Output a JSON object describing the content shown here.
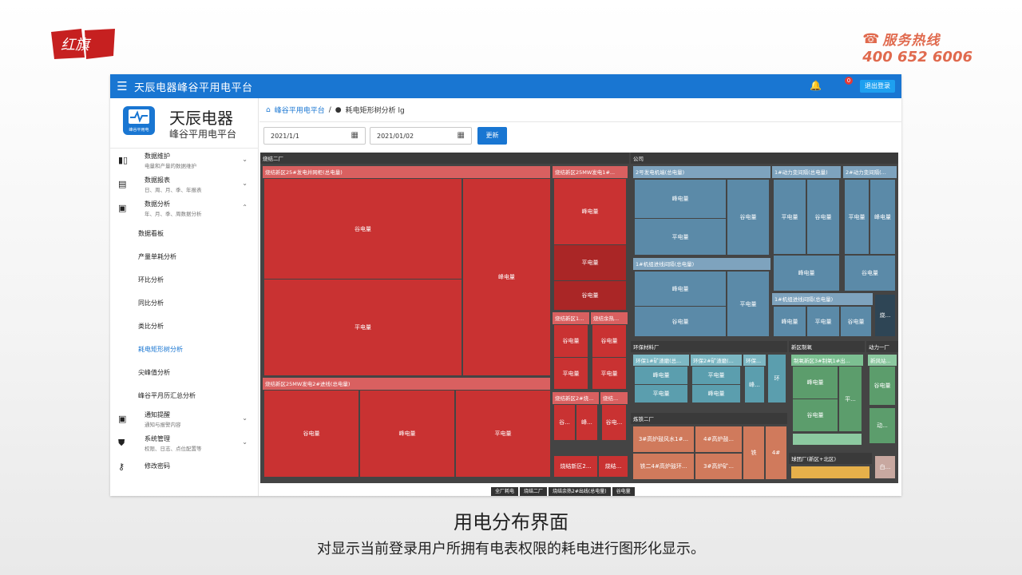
{
  "brand": {
    "logo_text": "红旗",
    "hotline_label": "服务热线",
    "hotline_number": "400 652 6006"
  },
  "app": {
    "title": "天辰电器峰谷平用电平台",
    "notifications": "0",
    "logout_label": "退出登录",
    "sidebar": {
      "name": "天辰电器",
      "subtitle": "峰谷平用电平台",
      "logo_caption": "峰谷平用电",
      "items": [
        {
          "label": "数据维护",
          "desc": "电量和产量的数据维护",
          "icon": "book-icon",
          "chevron": "⌄"
        },
        {
          "label": "数据报表",
          "desc": "日、周、月、季、年报表",
          "icon": "report-icon",
          "chevron": "⌄"
        },
        {
          "label": "数据分析",
          "desc": "年、月、季、周数据分析",
          "icon": "chart-icon",
          "chevron": "⌃"
        }
      ],
      "sub_items": [
        "数据看板",
        "产量单耗分析",
        "环比分析",
        "同比分析",
        "类比分析",
        "耗电矩形树分析",
        "尖峰值分析",
        "峰谷平月历汇总分析"
      ],
      "active_sub": "耗电矩形树分析",
      "bottom_items": [
        {
          "label": "通知提醒",
          "desc": "通知与报警内容",
          "icon": "bell-chart-icon",
          "chevron": "⌄"
        },
        {
          "label": "系统管理",
          "desc": "权限、日志、点位配置等",
          "icon": "shield-icon",
          "chevron": "⌄"
        },
        {
          "label": "修改密码",
          "desc": "",
          "icon": "key-icon",
          "chevron": ""
        }
      ]
    },
    "breadcrumb": {
      "home": "峰谷平用电平台",
      "sep": "/",
      "current": "耗电矩形树分析 lg"
    },
    "filters": {
      "start_date": "2021/1/1",
      "end_date": "2021/01/02",
      "update_label": "更新"
    },
    "treemap_path": [
      "全厂耗电",
      "烧结二厂",
      "烧结余热2#出线(总电量)",
      "谷电量"
    ]
  },
  "colors": {
    "primary": "#1976d2",
    "red": "#c93232",
    "blue": "#5b8aa8",
    "teal": "#5b9eae",
    "green": "#5c9d6c",
    "orange": "#d07a5c"
  },
  "treemap": {
    "groups": {
      "g1": "烧结二厂",
      "g2": "公司",
      "g3": "环保材料厂",
      "g4": "新区制氧",
      "g5": "动力一厂",
      "g6": "炼铁二厂",
      "g7": "球团厂(新区+北区)"
    },
    "sub": {
      "s1": "烧结新区25#发电并网柜(总电量)",
      "s2": "烧结新区25MW发电1#...",
      "s3": "烧结新区25MW发电2#进线(总电量)",
      "s4": "烧结新区1...",
      "s5": "烧结余热...",
      "s6": "烧结新区2#烧...",
      "s7": "烧结...",
      "s8": "2号发电机端(总电量)",
      "s9": "1#动力变间隔(总电量)",
      "s10": "2#动力变间隔(...",
      "s11": "1#机组进线间隔(总电量)",
      "s12": "1#机组进线间隔(总电量)",
      "s13": "环保1#矿渣磨(总...",
      "s14": "环保2#矿渣磨(...",
      "s15": "环保...",
      "s16": "制氧新区3#制氧1#出...",
      "s17": "新风站...",
      "s18": "3#高炉鼓风水1#...",
      "s19": "4#高炉鼓...",
      "s20": "铁二4#高炉鼓环...",
      "s21": "3#高炉矿..."
    },
    "v": {
      "gu": "谷电量",
      "feng": "峰电量",
      "ping": "平电量",
      "gu_short": "谷...",
      "feng_short": "峰...",
      "ping_short": "平...",
      "gudian": "谷电...",
      "huan": "环",
      "tie": "铁",
      "t4": "4#",
      "shao": "烧...",
      "dong": "动...",
      "bai": "白...",
      "shaojie": "烧结新区2...",
      "shaojie2": "烧结..."
    }
  },
  "caption": {
    "title": "用电分布界面",
    "subtitle": "对显示当前登录用户所拥有电表权限的耗电进行图形化显示。"
  }
}
